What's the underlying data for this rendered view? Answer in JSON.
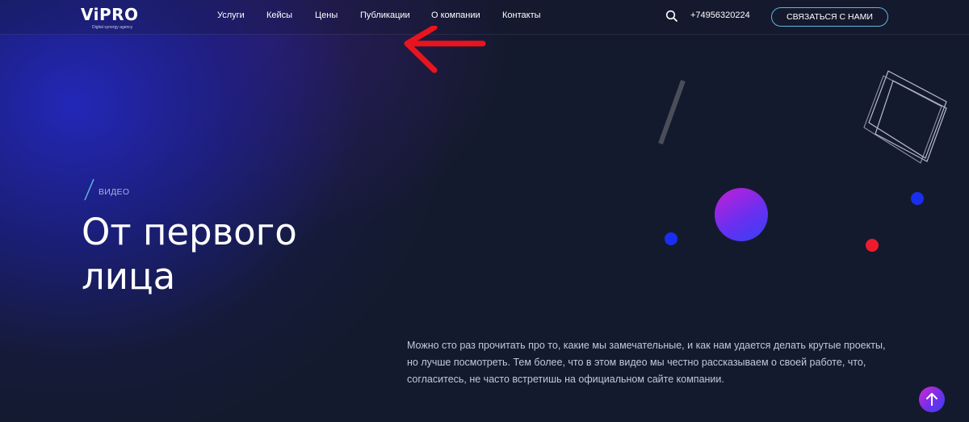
{
  "header": {
    "logo_text": "ViPRO",
    "logo_tagline": "Digital synergy agency",
    "nav": [
      {
        "label": "Услуги"
      },
      {
        "label": "Кейсы"
      },
      {
        "label": "Цены"
      },
      {
        "label": "Публикации"
      },
      {
        "label": "О компании"
      },
      {
        "label": "Контакты"
      }
    ],
    "search_icon": "search-icon",
    "phone": "+74956320224",
    "contact_button": "СВЯЗАТЬСЯ С НАМИ"
  },
  "hero": {
    "category": "ВИДЕО",
    "title_line1": "От первого",
    "title_line2": "лица",
    "description": "Можно сто раз прочитать про то, какие мы замечательные, и как нам удается делать крутые проекты, но лучше посмотреть. Тем более, что в этом видео мы честно рассказываем о своей работе, что, согласитесь, не часто встретишь на официальном сайте компании."
  },
  "annotation": {
    "arrow_icon": "red-left-arrow-icon"
  },
  "scroll_top_icon": "arrow-up-icon",
  "colors": {
    "background": "#141a2e",
    "accent_cyan": "#5fb8dc",
    "deco_blue": "#1a2ef0",
    "deco_red": "#ee1b2e",
    "gradient_magenta": "#c51fd6",
    "annotation_red": "#e8141e"
  }
}
